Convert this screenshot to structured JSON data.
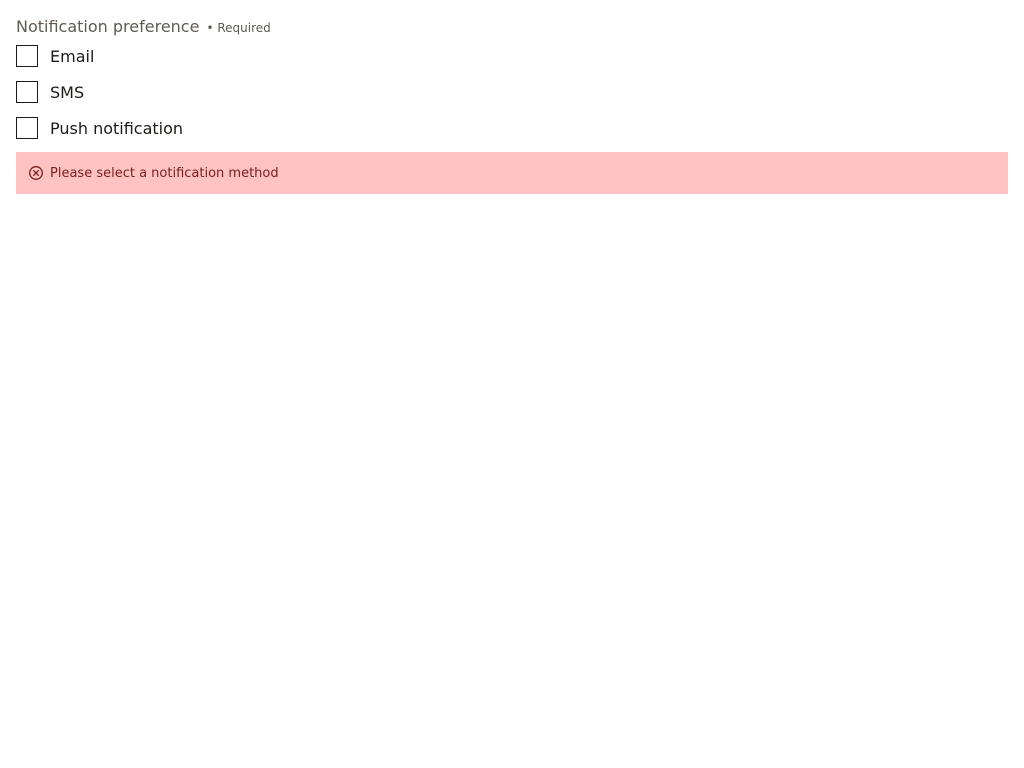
{
  "form": {
    "legend": "Notification preference",
    "required_marker": "• Required",
    "options": [
      {
        "label": "Email",
        "checked": false
      },
      {
        "label": "SMS",
        "checked": false
      },
      {
        "label": "Push notification",
        "checked": false
      }
    ],
    "error": {
      "icon": "error-circle-x-icon",
      "message": "Please select a notification method"
    }
  },
  "colors": {
    "error_background": "#ffc4c2",
    "error_text": "#7a1d1a",
    "label_text": "#605a52",
    "option_text": "#1d1b18"
  }
}
